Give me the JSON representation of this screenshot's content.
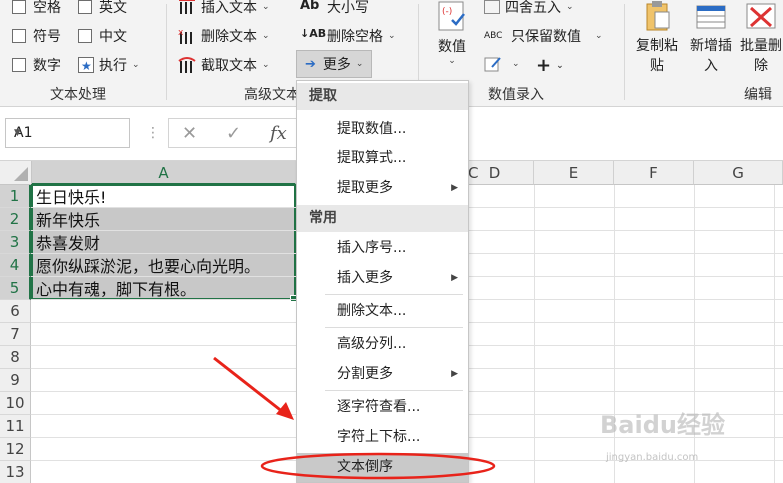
{
  "ribbon": {
    "text_processing": {
      "checkboxes": [
        "空格",
        "英文",
        "符号",
        "中文",
        "数字"
      ],
      "execute_label": "执行",
      "group_label": "文本处理"
    },
    "advanced_text": {
      "insert_text": "插入文本",
      "delete_text": "删除文本",
      "extract_text": "截取文本",
      "case_label": "大小写",
      "delete_space": "删除空格",
      "more_label": "更多",
      "group_label": "高级文本"
    },
    "value_entry": {
      "value_label": "数值",
      "round_label": "四舍五入",
      "keep_value": "只保留数值",
      "group_label": "数值录入"
    },
    "edit": {
      "copy_paste": "复制粘贴",
      "add_insert": "新增插入",
      "batch_delete": "批量删除",
      "group_label": "编辑"
    }
  },
  "formula_bar": {
    "name_box": "A1",
    "fx": "fx"
  },
  "grid": {
    "columns": [
      "A",
      "B",
      "C",
      "D",
      "E",
      "F",
      "G"
    ],
    "rows": [
      "1",
      "2",
      "3",
      "4",
      "5",
      "6",
      "7",
      "8",
      "9",
      "10",
      "11",
      "12",
      "13"
    ],
    "cells": [
      "生日快乐!",
      "新年快乐",
      "恭喜发财",
      "愿你纵踩淤泥，也要心向光明。",
      "心中有魂，脚下有根。"
    ]
  },
  "menu": {
    "section_extract": "提取",
    "extract_value": "提取数值...",
    "extract_formula": "提取算式...",
    "extract_more": "提取更多",
    "section_common": "常用",
    "insert_seq": "插入序号...",
    "insert_more": "插入更多",
    "delete_text": "删除文本...",
    "adv_split": "高级分列...",
    "split_more": "分割更多",
    "char_view": "逐字符查看...",
    "char_subsup": "字符上下标...",
    "text_reverse": "文本倒序"
  },
  "watermark": {
    "brand": "Baidu经验",
    "url": "jingyan.baidu.com"
  }
}
